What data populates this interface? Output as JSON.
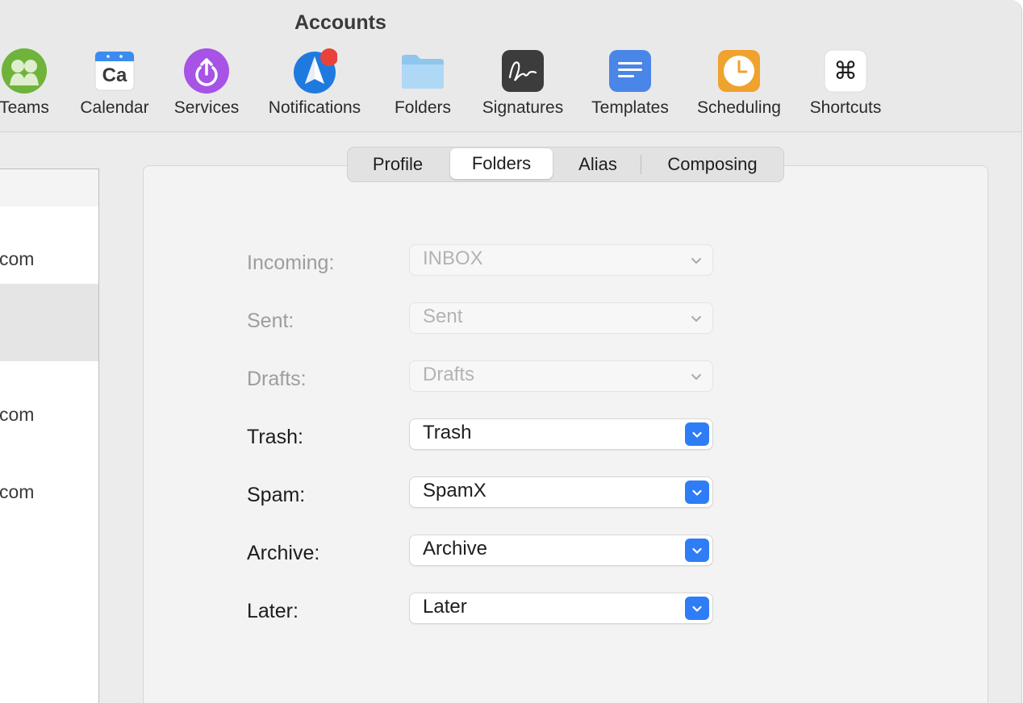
{
  "window": {
    "title": "Accounts"
  },
  "toolbar": [
    {
      "label": "Teams",
      "icon": "teams-icon"
    },
    {
      "label": "Calendar",
      "icon": "calendar-icon",
      "icon_text": "Ca"
    },
    {
      "label": "Services",
      "icon": "services-icon"
    },
    {
      "label": "Notifications",
      "icon": "notifications-icon"
    },
    {
      "label": "Folders",
      "icon": "folder-icon"
    },
    {
      "label": "Signatures",
      "icon": "signature-icon"
    },
    {
      "label": "Templates",
      "icon": "templates-icon"
    },
    {
      "label": "Scheduling",
      "icon": "clock-icon"
    },
    {
      "label": "Shortcuts",
      "icon": "command-icon",
      "icon_text": "⌘"
    }
  ],
  "accounts": [
    {
      "text": "com"
    },
    {
      "text": "com"
    },
    {
      "text": "com"
    }
  ],
  "tabs": [
    {
      "label": "Profile"
    },
    {
      "label": "Folders",
      "active": true
    },
    {
      "label": "Alias"
    },
    {
      "label": "Composing"
    }
  ],
  "fields": [
    {
      "label": "Incoming:",
      "value": "INBOX",
      "enabled": false
    },
    {
      "label": "Sent:",
      "value": "Sent",
      "enabled": false
    },
    {
      "label": "Drafts:",
      "value": "Drafts",
      "enabled": false
    },
    {
      "label": "Trash:",
      "value": "Trash",
      "enabled": true
    },
    {
      "label": "Spam:",
      "value": "SpamX",
      "enabled": true
    },
    {
      "label": "Archive:",
      "value": "Archive",
      "enabled": true
    },
    {
      "label": "Later:",
      "value": "Later",
      "enabled": true
    }
  ],
  "colors": {
    "accent": "#2f7df6",
    "notification_badge": "#e9423a"
  }
}
